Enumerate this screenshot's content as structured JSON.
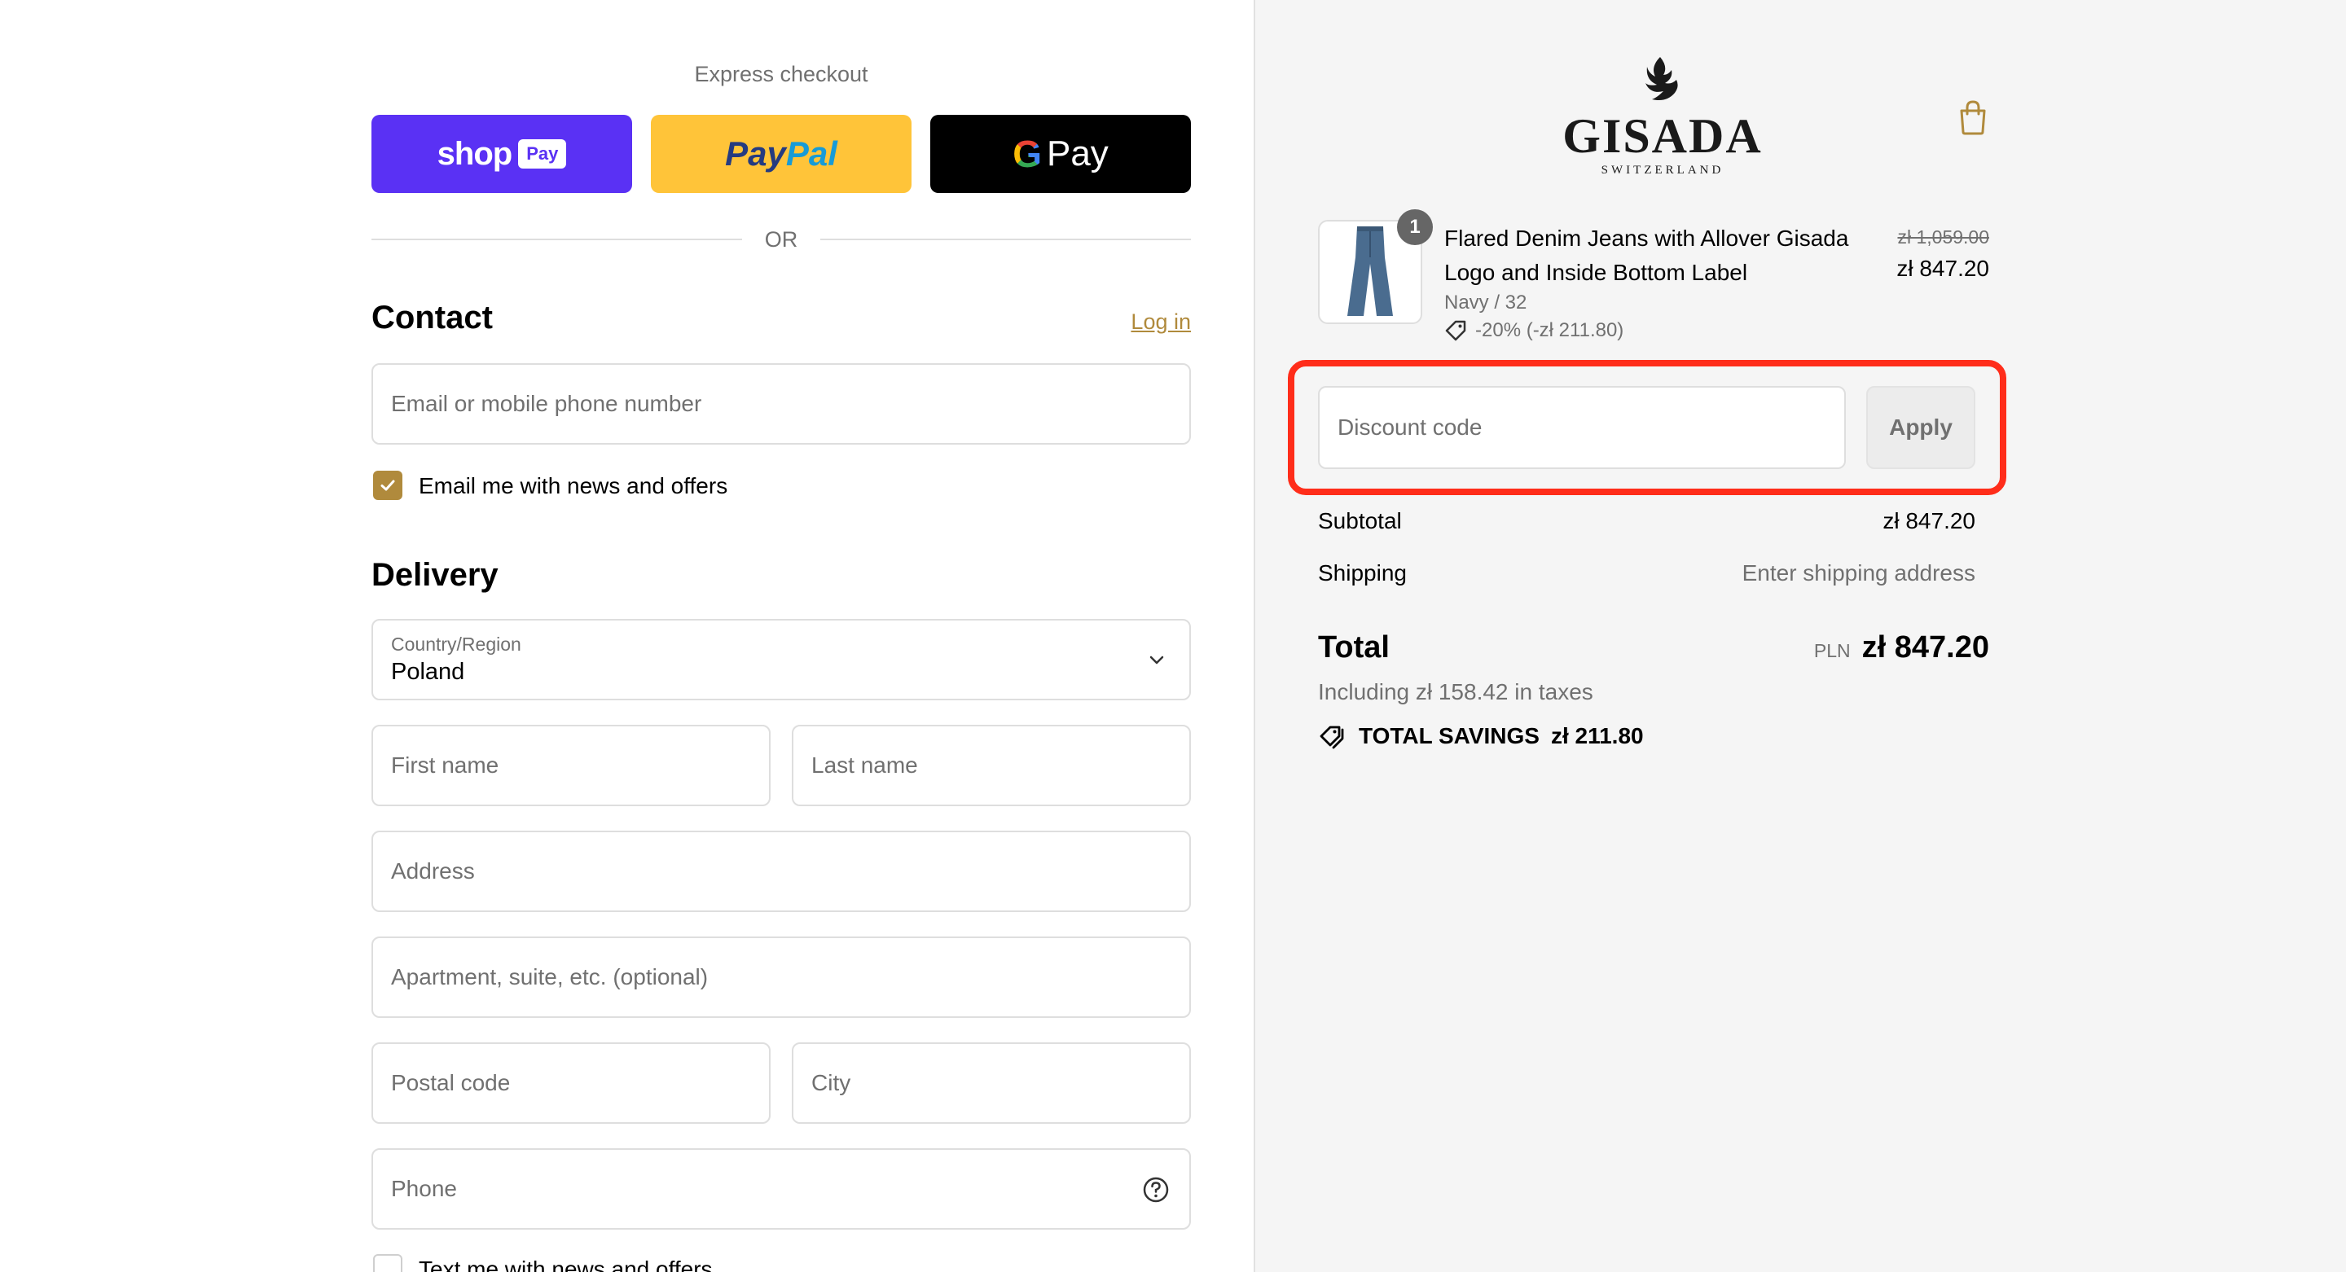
{
  "express": {
    "title": "Express checkout",
    "shop_pay": {
      "word": "shop",
      "badge": "Pay"
    },
    "paypal": {
      "part1": "Pay",
      "part2": "Pal"
    },
    "gpay": {
      "g": "G",
      "word": "Pay"
    },
    "or_label": "OR"
  },
  "contact": {
    "title": "Contact",
    "login_label": "Log in",
    "email_placeholder": "Email or mobile phone number",
    "newsletter_label": "Email me with news and offers",
    "newsletter_checked": true
  },
  "delivery": {
    "title": "Delivery",
    "country_label": "Country/Region",
    "country_value": "Poland",
    "first_name_placeholder": "First name",
    "last_name_placeholder": "Last name",
    "address_placeholder": "Address",
    "apartment_placeholder": "Apartment, suite, etc. (optional)",
    "postal_placeholder": "Postal code",
    "city_placeholder": "City",
    "phone_placeholder": "Phone",
    "sms_label": "Text me with news and offers"
  },
  "brand": {
    "name": "GISADA",
    "tagline": "SWITZERLAND"
  },
  "cart": {
    "quantity": "1",
    "product_name": "Flared Denim Jeans with Allover Gisada Logo and Inside Bottom Label",
    "variant": "Navy / 32",
    "discount_note": "-20% (-zł 211.80)",
    "price_original": "zł 1,059.00",
    "price_final": "zł 847.20"
  },
  "discount": {
    "placeholder": "Discount code",
    "apply_label": "Apply"
  },
  "summary": {
    "subtotal_label": "Subtotal",
    "subtotal_value": "zł 847.20",
    "shipping_label": "Shipping",
    "shipping_value": "Enter shipping address",
    "total_label": "Total",
    "total_currency": "PLN",
    "total_value": "zł 847.20",
    "taxes_note": "Including zł 158.42 in taxes",
    "savings_label": "TOTAL SAVINGS",
    "savings_value": "zł 211.80"
  },
  "colors": {
    "accent": "#b08a3c",
    "shop_pay": "#5a31f4",
    "paypal": "#ffc439",
    "highlight": "#ff2d1a"
  }
}
